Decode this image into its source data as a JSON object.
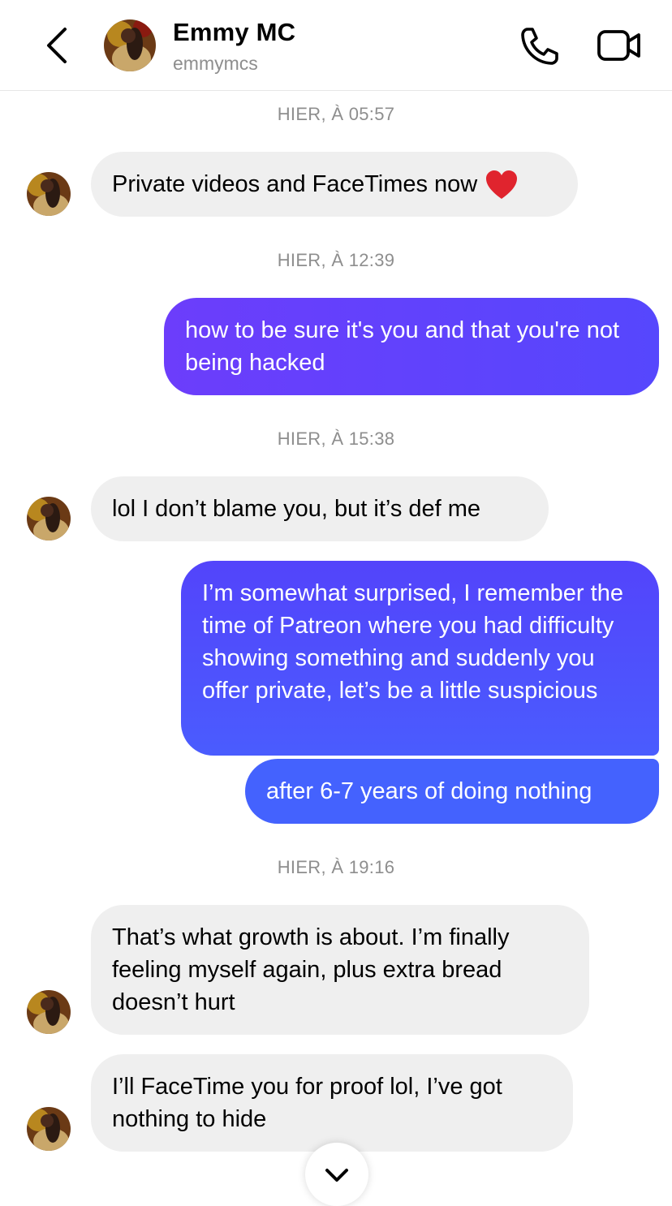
{
  "header": {
    "name": "Emmy MC",
    "username": "emmymcs"
  },
  "icons": {
    "back": "chevron-left-icon",
    "call": "phone-icon",
    "video": "video-camera-icon",
    "scroll": "chevron-down-icon",
    "heart": "red-heart-emoji"
  },
  "colors": {
    "incoming_bubble": "#efefef",
    "outgoing_top": "#6c3dfb",
    "outgoing_bottom": "#4462fe",
    "timestamp": "#8e8e8e",
    "heart": "#e0242e"
  },
  "timestamps": [
    "HIER, À 05:57",
    "HIER, À 12:39",
    "HIER, À 15:38",
    "HIER, À 19:16"
  ],
  "messages": [
    {
      "sender": "them",
      "text": "Private videos and FaceTimes now"
    },
    {
      "sender": "me",
      "text": "how to be sure it's you and that you're not being hacked"
    },
    {
      "sender": "them",
      "text": "lol I don’t blame you, but it’s def me"
    },
    {
      "sender": "me",
      "text": "I’m somewhat surprised, I remember the time of Patreon where you had difficulty showing something and suddenly you offer private, let’s be a little suspicious"
    },
    {
      "sender": "me",
      "text": "after 6-7 years of doing nothing"
    },
    {
      "sender": "them",
      "text": "That’s what growth is about. I’m finally feeling myself again, plus extra bread doesn’t hurt"
    },
    {
      "sender": "them",
      "text": "I’ll FaceTime you for proof lol, I’ve got nothing to hide"
    }
  ]
}
